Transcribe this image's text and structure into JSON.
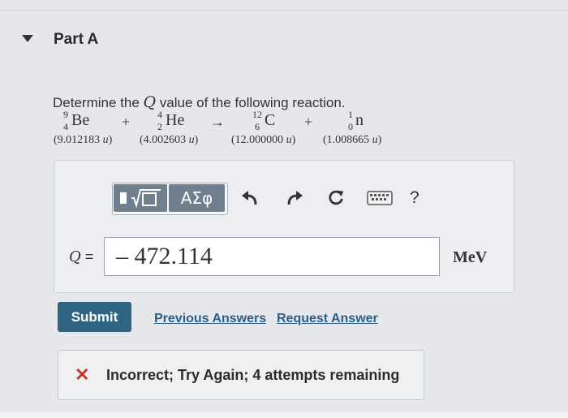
{
  "part": {
    "title": "Part A"
  },
  "question": {
    "prefix": "Determine the ",
    "q_symbol": "Q",
    "suffix": " value of the following reaction."
  },
  "reaction": {
    "be": {
      "symbol": "Be",
      "mass_number": "9",
      "atomic_number": "4",
      "mass": "(9.012183 ",
      "unit": "u",
      "close": ")"
    },
    "he": {
      "symbol": "He",
      "mass_number": "4",
      "atomic_number": "2",
      "mass": "(4.002603 ",
      "unit": "u",
      "close": ")"
    },
    "c": {
      "symbol": "C",
      "mass_number": "12",
      "atomic_number": "6",
      "mass": "(12.000000 ",
      "unit": "u",
      "close": ")"
    },
    "n": {
      "symbol": "n",
      "mass_number": "1",
      "atomic_number": "0",
      "mass": "(1.008665 ",
      "unit": "u",
      "close": ")"
    },
    "plus": "+",
    "arrow": "→"
  },
  "toolbar": {
    "greek_label": "ΑΣφ",
    "help_label": "?"
  },
  "answer": {
    "label_symbol": "Q",
    "label_equals": " =",
    "value": "– 472.114",
    "unit": "MeV"
  },
  "actions": {
    "submit_label": "Submit",
    "previous_answers_label": "Previous Answers",
    "request_answer_label": "Request Answer"
  },
  "feedback": {
    "icon": "✕",
    "message": "Incorrect; Try Again; 4 attempts remaining"
  },
  "colors": {
    "submit_bg": "#2e6480",
    "link": "#2a5f8a",
    "error": "#c0392b",
    "toolbar_btn": "#6f7f8e"
  }
}
